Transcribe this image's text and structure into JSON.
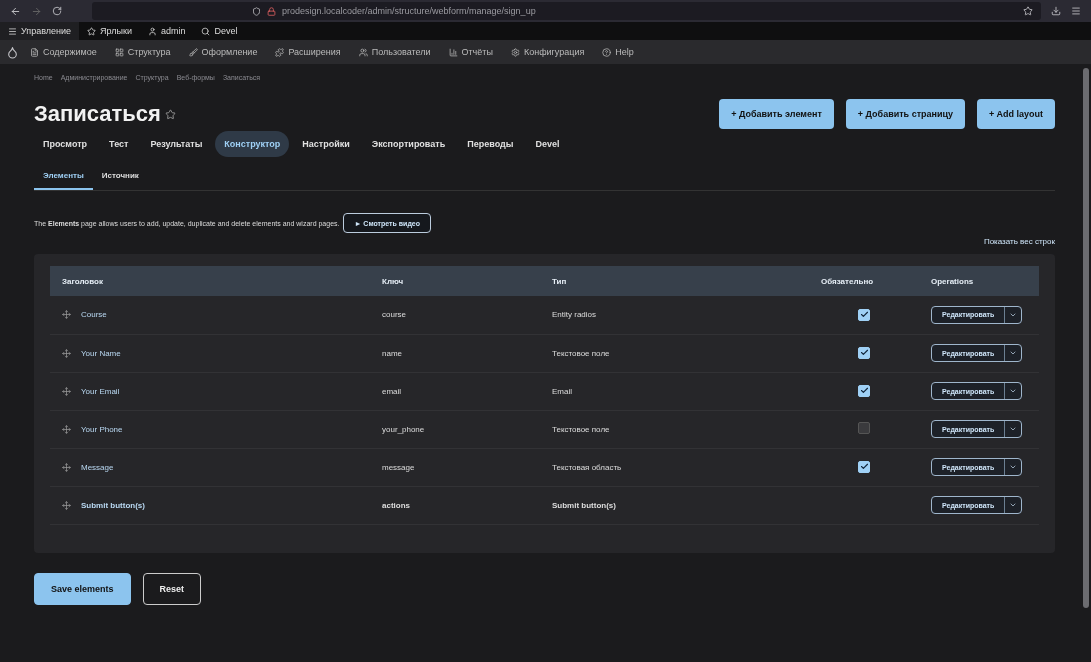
{
  "browser": {
    "url": "prodesign.localcoder/admin/structure/webform/manage/sign_up"
  },
  "toolbar": {
    "items": [
      "Управление",
      "Ярлыки",
      "admin",
      "Devel"
    ]
  },
  "admin_menu": {
    "items": [
      "Содержимое",
      "Структура",
      "Оформление",
      "Расширения",
      "Пользователи",
      "Отчёты",
      "Конфигурация",
      "Help"
    ]
  },
  "breadcrumb": [
    "Home",
    "Администрирование",
    "Структура",
    "Веб-формы",
    "Записаться"
  ],
  "page": {
    "title": "Записаться"
  },
  "actions": [
    "+ Добавить элемент",
    "+ Добавить страницу",
    "+ Add layout"
  ],
  "tabs": [
    {
      "label": "Просмотр",
      "selected": false
    },
    {
      "label": "Тест",
      "selected": false
    },
    {
      "label": "Результаты",
      "selected": false
    },
    {
      "label": "Конструктор",
      "selected": true
    },
    {
      "label": "Настройки",
      "selected": false
    },
    {
      "label": "Экспортировать",
      "selected": false
    },
    {
      "label": "Переводы",
      "selected": false
    },
    {
      "label": "Devel",
      "selected": false
    }
  ],
  "subtabs": [
    {
      "label": "Элементы",
      "selected": true
    },
    {
      "label": "Источник",
      "selected": false
    }
  ],
  "description": "The **Elements** page allows users to add, update, duplicate and delete elements and wizard pages.",
  "video_button": "► Смотреть видео",
  "show_weights": "Показать вес строк",
  "table": {
    "columns": [
      "Заголовок",
      "Ключ",
      "Тип",
      "Обязательно",
      "Operations"
    ],
    "rows": [
      {
        "kind": "element",
        "title": "Course",
        "key": "course",
        "type": "Entity radios",
        "required": true,
        "operation": "Редактировать"
      },
      {
        "kind": "element",
        "title": "Your Name",
        "key": "name",
        "type": "Текстовое поле",
        "required": true,
        "operation": "Редактировать"
      },
      {
        "kind": "element",
        "title": "Your Email",
        "key": "email",
        "type": "Email",
        "required": true,
        "operation": "Редактировать"
      },
      {
        "kind": "element",
        "title": "Your Phone",
        "key": "your_phone",
        "type": "Текстовое поле",
        "required": false,
        "operation": "Редактировать"
      },
      {
        "kind": "element",
        "title": "Message",
        "key": "message",
        "type": "Текстовая область",
        "required": true,
        "operation": "Редактировать"
      },
      {
        "kind": "actions",
        "title": "Submit button(s)",
        "key": "actions",
        "type": "Submit button(s)",
        "operation": "Редактировать"
      }
    ]
  },
  "footer_buttons": [
    {
      "label": "Save elements",
      "kind": "primary"
    },
    {
      "label": "Reset",
      "kind": "secondary"
    }
  ]
}
